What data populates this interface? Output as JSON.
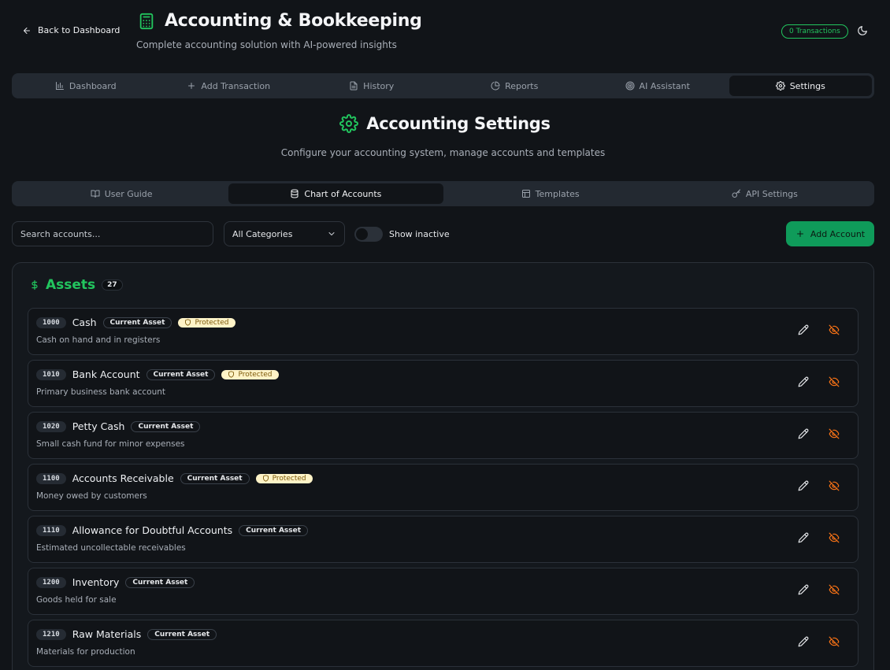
{
  "header": {
    "back_label": "Back to Dashboard",
    "title": "Accounting & Bookkeeping",
    "subtitle": "Complete accounting solution with AI-powered insights",
    "transactions_badge": "0 Transactions",
    "accent": "#22c55e"
  },
  "main_nav": {
    "tabs": [
      {
        "label": "Dashboard",
        "icon": "bar-chart-icon"
      },
      {
        "label": "Add Transaction",
        "icon": "plus-icon"
      },
      {
        "label": "History",
        "icon": "document-icon"
      },
      {
        "label": "Reports",
        "icon": "pie-chart-icon"
      },
      {
        "label": "AI Assistant",
        "icon": "target-icon"
      },
      {
        "label": "Settings",
        "icon": "gear-icon",
        "active": true
      }
    ]
  },
  "settings": {
    "title": "Accounting Settings",
    "description": "Configure your accounting system, manage accounts and templates"
  },
  "sub_nav": {
    "tabs": [
      {
        "label": "User Guide",
        "icon": "book-icon"
      },
      {
        "label": "Chart of Accounts",
        "icon": "database-icon",
        "active": true
      },
      {
        "label": "Templates",
        "icon": "layout-icon"
      },
      {
        "label": "API Settings",
        "icon": "key-icon"
      }
    ]
  },
  "toolbar": {
    "search_placeholder": "Search accounts...",
    "category_value": "All Categories",
    "show_inactive_label": "Show inactive",
    "show_inactive": false,
    "add_account_label": "Add Account"
  },
  "assets": {
    "title": "Assets",
    "count": "27",
    "accounts": [
      {
        "code": "1000",
        "name": "Cash",
        "type": "Current Asset",
        "protected": "Protected",
        "description": "Cash on hand and in registers"
      },
      {
        "code": "1010",
        "name": "Bank Account",
        "type": "Current Asset",
        "protected": "Protected",
        "description": "Primary business bank account"
      },
      {
        "code": "1020",
        "name": "Petty Cash",
        "type": "Current Asset",
        "protected": null,
        "description": "Small cash fund for minor expenses"
      },
      {
        "code": "1100",
        "name": "Accounts Receivable",
        "type": "Current Asset",
        "protected": "Protected",
        "description": "Money owed by customers"
      },
      {
        "code": "1110",
        "name": "Allowance for Doubtful Accounts",
        "type": "Current Asset",
        "protected": null,
        "description": "Estimated uncollectable receivables"
      },
      {
        "code": "1200",
        "name": "Inventory",
        "type": "Current Asset",
        "protected": null,
        "description": "Goods held for sale"
      },
      {
        "code": "1210",
        "name": "Raw Materials",
        "type": "Current Asset",
        "protected": null,
        "description": "Materials for production"
      }
    ]
  }
}
